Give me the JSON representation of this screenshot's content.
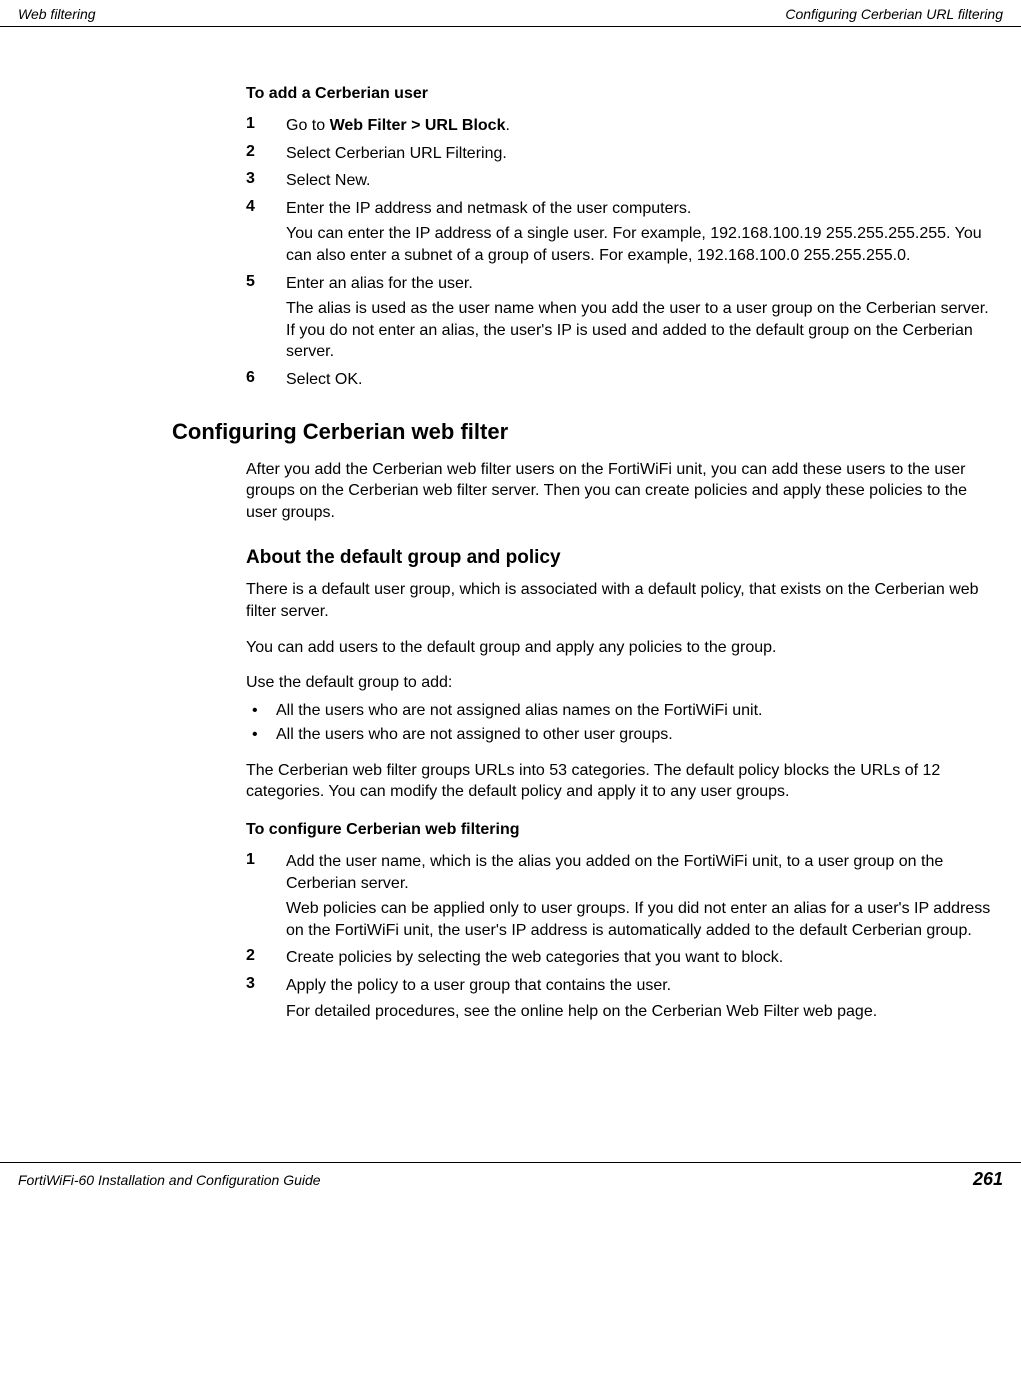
{
  "header": {
    "left": "Web filtering",
    "right": "Configuring Cerberian URL filtering"
  },
  "section1": {
    "title": "To add a Cerberian user",
    "steps": [
      {
        "num": "1",
        "text_prefix": "Go to ",
        "bold_text": "Web Filter > URL Block",
        "text_suffix": "."
      },
      {
        "num": "2",
        "text": "Select Cerberian URL Filtering."
      },
      {
        "num": "3",
        "text": "Select New."
      },
      {
        "num": "4",
        "text": "Enter the IP address and netmask of the user computers.",
        "para": "You can enter the IP address of a single user. For example, 192.168.100.19 255.255.255.255. You can also enter a subnet of a group of users. For example, 192.168.100.0 255.255.255.0."
      },
      {
        "num": "5",
        "text": "Enter an alias for the user.",
        "para": "The alias is used as the user name when you add the user to a user group on the Cerberian server. If you do not enter an alias, the user's IP is used and added to the default group on the Cerberian server."
      },
      {
        "num": "6",
        "text": "Select OK."
      }
    ]
  },
  "section2": {
    "heading": "Configuring Cerberian web filter",
    "para1": "After you add the Cerberian web filter users on the FortiWiFi unit, you can add these users to the user groups on the Cerberian web filter server. Then you can create policies and apply these policies to the user groups.",
    "sub_heading": "About the default group and policy",
    "para2": "There is a default user group, which is associated with a default policy, that exists on the Cerberian web filter server.",
    "para3": "You can add users to the default group and apply any policies to the group.",
    "para4": "Use the default group to add:",
    "bullets": [
      "All the users who are not assigned alias names on the FortiWiFi unit.",
      "All the users who are not assigned to other user groups."
    ],
    "para5": "The Cerberian web filter groups URLs into 53 categories. The default policy blocks the URLs of 12 categories. You can modify the default policy and apply it to any user groups.",
    "title2": "To configure Cerberian web filtering",
    "steps2": [
      {
        "num": "1",
        "text": "Add the user name, which is the alias you added on the FortiWiFi unit, to a user group on the Cerberian server.",
        "para": "Web policies can be applied only to user groups. If you did not enter an alias for a user's IP address on the FortiWiFi unit, the user's IP address is automatically added to the default Cerberian group."
      },
      {
        "num": "2",
        "text": "Create policies by selecting the web categories that you want to block."
      },
      {
        "num": "3",
        "text": "Apply the policy to a user group that contains the user.",
        "para": "For detailed procedures, see the online help on the Cerberian Web Filter web page."
      }
    ]
  },
  "footer": {
    "left": "FortiWiFi-60 Installation and Configuration Guide",
    "right": "261"
  }
}
